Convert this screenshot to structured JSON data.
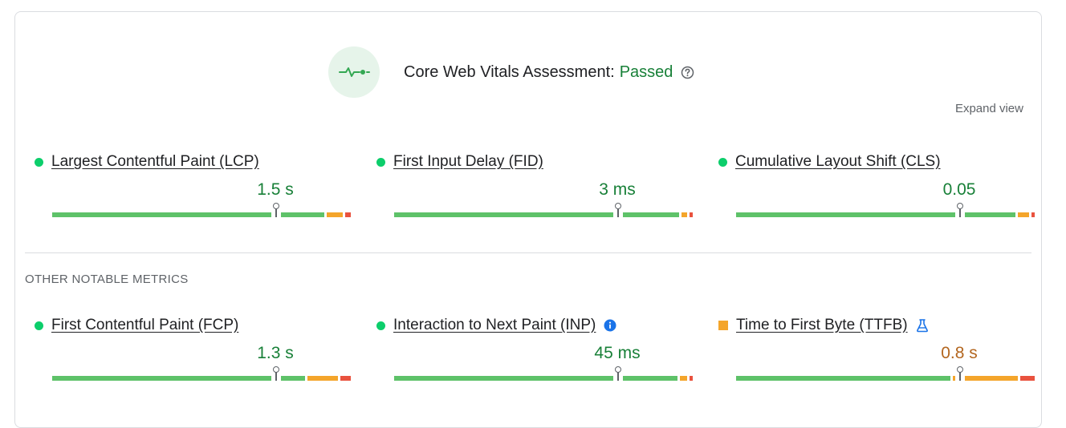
{
  "assessment": {
    "label": "Core Web Vitals Assessment:",
    "status": "Passed",
    "status_color": "#188038",
    "icon": "vitals-pulse-icon",
    "help_icon": "help-circle-icon"
  },
  "expand_label": "Expand view",
  "section_other": "OTHER NOTABLE METRICS",
  "colors": {
    "good": "#5ec269",
    "needs_improvement": "#f4a52b",
    "poor": "#e9523e"
  },
  "core_metrics": [
    {
      "name": "Largest Contentful Paint (LCP)",
      "value": "1.5 s",
      "rating": "good",
      "distribution": {
        "good": 0.925,
        "needs_improvement": 0.055,
        "poor": 0.02
      },
      "percentile_position": 0.75
    },
    {
      "name": "First Input Delay (FID)",
      "value": "3 ms",
      "rating": "good",
      "distribution": {
        "good": 0.97,
        "needs_improvement": 0.02,
        "poor": 0.01
      },
      "percentile_position": 0.75
    },
    {
      "name": "Cumulative Layout Shift (CLS)",
      "value": "0.05",
      "rating": "good",
      "distribution": {
        "good": 0.95,
        "needs_improvement": 0.04,
        "poor": 0.01
      },
      "percentile_position": 0.75
    }
  ],
  "other_metrics": [
    {
      "name": "First Contentful Paint (FCP)",
      "value": "1.3 s",
      "rating": "good",
      "distribution": {
        "good": 0.86,
        "needs_improvement": 0.105,
        "poor": 0.035
      },
      "percentile_position": 0.75
    },
    {
      "name": "Interaction to Next Paint (INP)",
      "value": "45 ms",
      "rating": "good",
      "badge_icon": "info-icon",
      "distribution": {
        "good": 0.965,
        "needs_improvement": 0.025,
        "poor": 0.01
      },
      "percentile_position": 0.75
    },
    {
      "name": "Time to First Byte (TTFB)",
      "value": "0.8 s",
      "rating": "needs_improvement",
      "badge_icon": "flask-icon",
      "distribution": {
        "good": 0.73,
        "needs_improvement": 0.22,
        "poor": 0.05
      },
      "percentile_position": 0.75
    }
  ]
}
